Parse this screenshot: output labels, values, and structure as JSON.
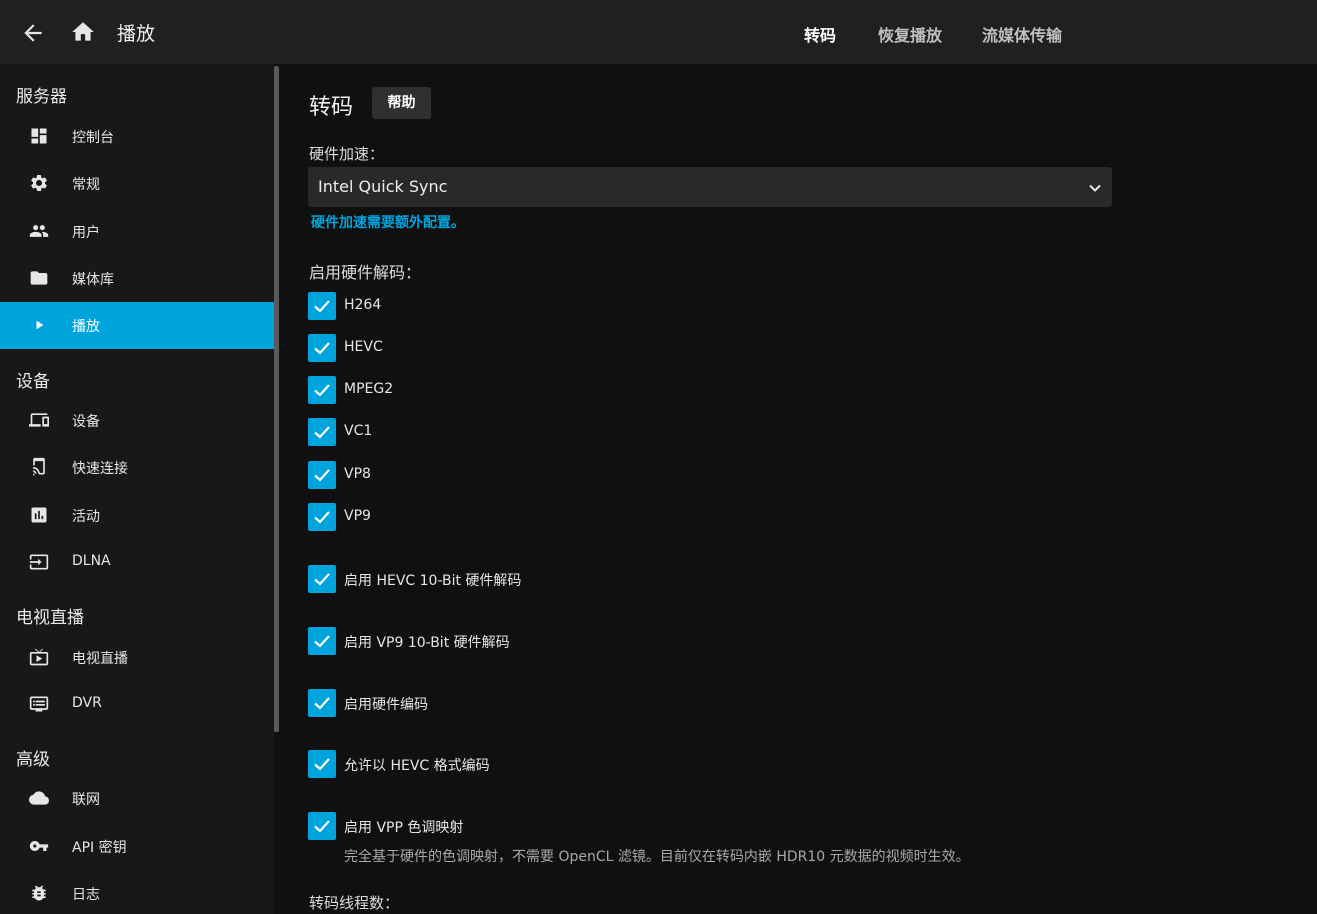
{
  "header": {
    "title": "播放",
    "tabs": [
      {
        "label": "转码",
        "active": true
      },
      {
        "label": "恢复播放",
        "active": false
      },
      {
        "label": "流媒体传输",
        "active": false
      }
    ]
  },
  "sidebar": {
    "sections": {
      "server": "服务器",
      "devices": "设备",
      "livetv": "电视直播",
      "advanced": "高级"
    },
    "items": {
      "dashboard": "控制台",
      "general": "常规",
      "users": "用户",
      "libraries": "媒体库",
      "playback": "播放",
      "devices": "设备",
      "quickconnect": "快速连接",
      "activity": "活动",
      "dlna": "DLNA",
      "livetv": "电视直播",
      "dvr": "DVR",
      "networking": "联网",
      "apikeys": "API 密钥",
      "logs": "日志"
    }
  },
  "main": {
    "title": "转码",
    "help_label": "帮助",
    "hw_accel_label": "硬件加速：",
    "hw_accel_value": "Intel Quick Sync",
    "hw_accel_note": "硬件加速需要额外配置。",
    "decode_label": "启用硬件解码：",
    "codecs": {
      "h264": "H264",
      "hevc": "HEVC",
      "mpeg2": "MPEG2",
      "vc1": "VC1",
      "vp8": "VP8",
      "vp9": "VP9"
    },
    "options": {
      "hevc10": "启用 HEVC 10-Bit 硬件解码",
      "vp910": "启用 VP9 10-Bit 硬件解码",
      "hwencode": "启用硬件编码",
      "hevcencode": "允许以 HEVC 格式编码",
      "vpp": "启用 VPP 色调映射",
      "vpp_desc": "完全基于硬件的色调映射，不需要 OpenCL 滤镜。目前仅在转码内嵌 HDR10 元数据的视频时生效。"
    },
    "threads_label": "转码线程数："
  },
  "colors": {
    "accent": "#00a4dc",
    "header_bg": "#202020",
    "sidebar_bg": "#181818",
    "page_bg": "#101010"
  }
}
